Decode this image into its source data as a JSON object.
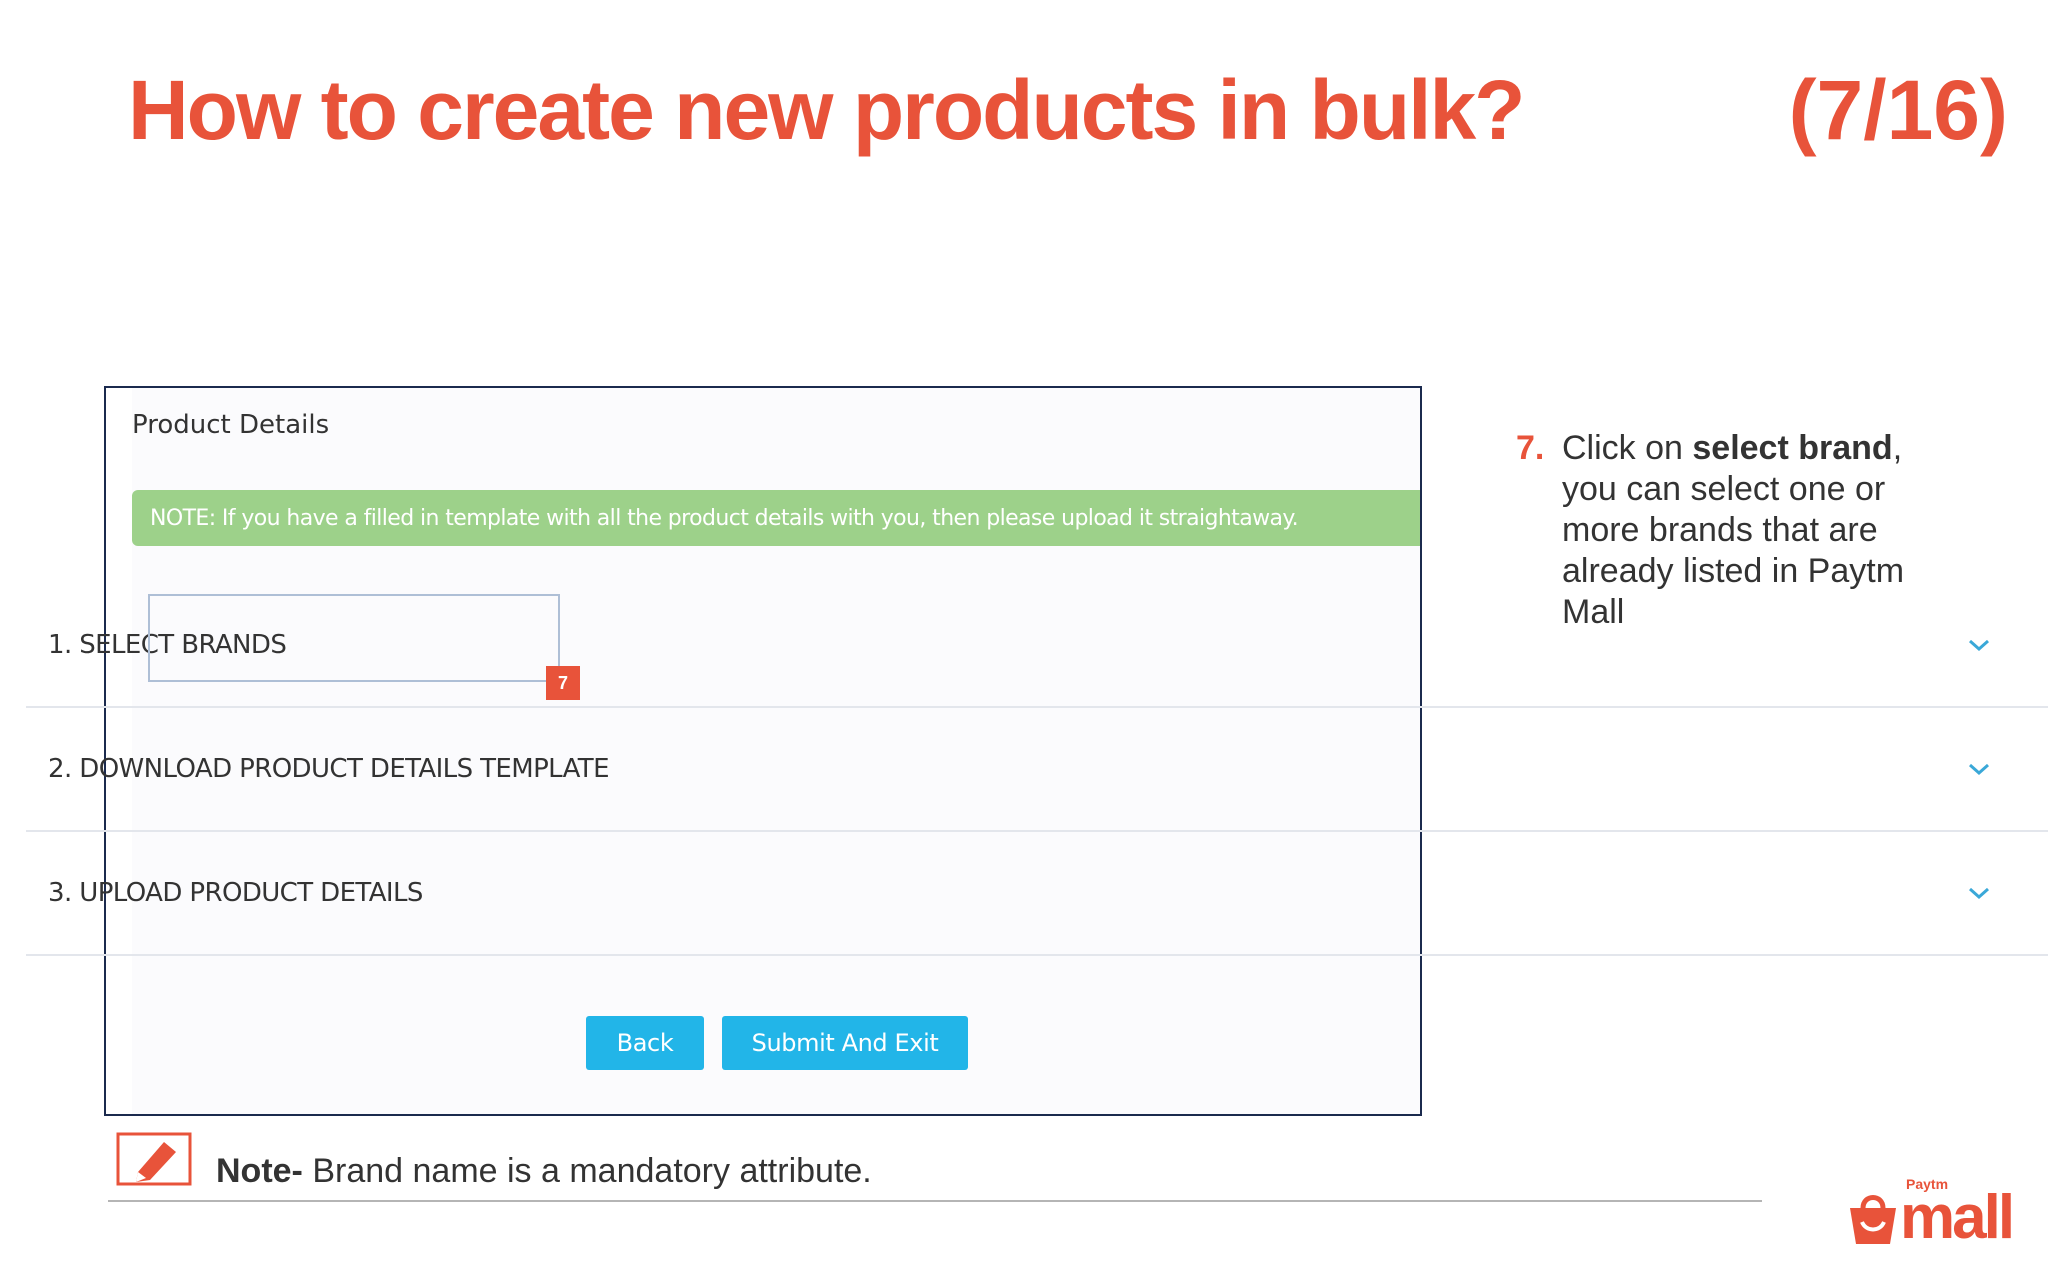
{
  "slide": {
    "title": "How to create new products in bulk?",
    "counter": "(7/16)"
  },
  "panel": {
    "heading": "Product Details",
    "note": "NOTE: If you have a filled in template with all the product details with you, then please upload it straightaway.",
    "steps": [
      {
        "label": "1. SELECT BRANDS"
      },
      {
        "label": "2. DOWNLOAD PRODUCT DETAILS TEMPLATE"
      },
      {
        "label": "3. UPLOAD PRODUCT DETAILS"
      }
    ],
    "marker": "7",
    "buttons": {
      "back": "Back",
      "submit": "Submit And Exit"
    }
  },
  "instruction": {
    "number": "7.",
    "before": "Click on ",
    "bold": "select brand",
    "after": ", you can select one or more brands that are already listed in Paytm Mall"
  },
  "footer": {
    "note_label": "Note-",
    "note_text": " Brand name is a mandatory attribute."
  },
  "logo": {
    "small": "Paytm",
    "main": "mall"
  },
  "colors": {
    "accent": "#e8533a",
    "note_green": "#9dd18a",
    "button_blue": "#22b5e8",
    "panel_border": "#1b2a4e",
    "chevron": "#3aa8d8"
  },
  "icons": {
    "chevron": "chevron-down-icon",
    "note": "pencil-note-icon",
    "logo_bag": "shopping-bag-icon"
  }
}
